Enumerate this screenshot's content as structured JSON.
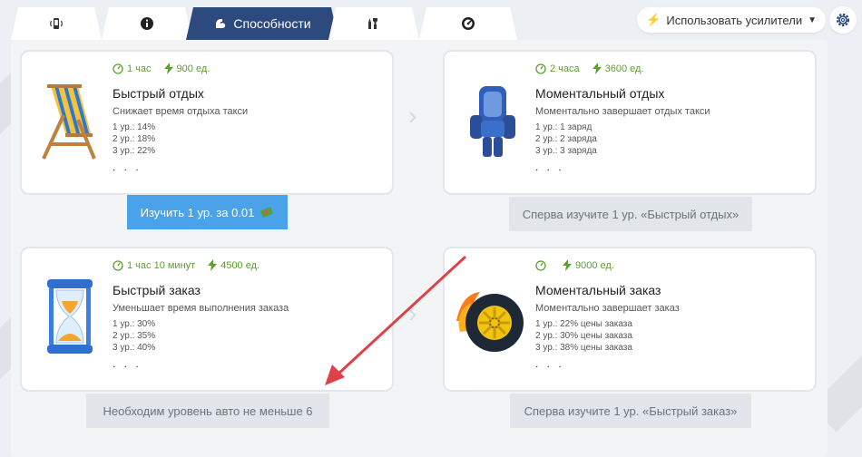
{
  "tabs": [
    {
      "name": "phone-icon",
      "label": ""
    },
    {
      "name": "info-icon",
      "label": ""
    },
    {
      "name": "abilities",
      "label": "Способности",
      "active": true
    },
    {
      "name": "tools-icon",
      "label": ""
    },
    {
      "name": "speedometer-icon",
      "label": ""
    }
  ],
  "boost": {
    "label": "Использовать усилители"
  },
  "cards": [
    {
      "time": "1 час",
      "cost": "900 ед.",
      "title": "Быстрый отдых",
      "desc": "Снижает время отдыха такси",
      "levels": [
        "1 ур.: 14%",
        "2 ур.: 18%",
        "3 ур.: 22%"
      ],
      "more": ". . .",
      "action": "Изучить 1 ур. за 0.01"
    },
    {
      "time": "2 часа",
      "cost": "3600 ед.",
      "title": "Моментальный отдых",
      "desc": "Моментально завершает отдых такси",
      "levels": [
        "1 ур.: 1 заряд",
        "2 ур.: 2 заряда",
        "3 ур.: 3 заряда"
      ],
      "more": ". . .",
      "action": "Сперва изучите 1 ур. «Быстрый отдых»"
    },
    {
      "time": "1 час 10 минут",
      "cost": "4500 ед.",
      "title": "Быстрый заказ",
      "desc": "Уменьшает время выполнения заказа",
      "levels": [
        "1 ур.: 30%",
        "2 ур.: 35%",
        "3 ур.: 40%"
      ],
      "more": ". . .",
      "action": "Необходим уровень авто не меньше 6"
    },
    {
      "time": "",
      "cost": "9000 ед.",
      "title": "Моментальный заказ",
      "desc": "Моментально завершает заказ",
      "levels": [
        "1 ур.: 22% цены заказа",
        "2 ур.: 30% цены заказа",
        "3 ур.: 38% цены заказа"
      ],
      "more": ". . .",
      "action": "Сперва изучите 1 ур. «Быстрый заказ»"
    }
  ],
  "colors": {
    "accent": "#2c4a7e",
    "primary_button": "#4aa3e8",
    "green": "#5aa02c",
    "annotation_arrow": "#e04048"
  }
}
